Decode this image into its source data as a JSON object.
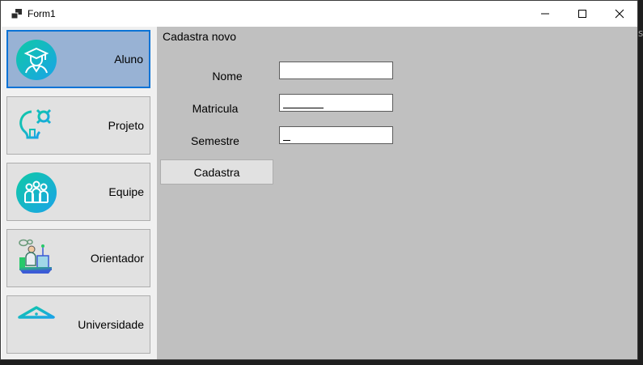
{
  "window": {
    "title": "Form1",
    "controls": [
      "minimize-icon",
      "maximize-icon",
      "close-icon"
    ]
  },
  "sidebar": {
    "items": [
      {
        "label": "Aluno",
        "icon": "graduate-icon",
        "active": true
      },
      {
        "label": "Projeto",
        "icon": "lightbulb-gear-icon",
        "active": false
      },
      {
        "label": "Equipe",
        "icon": "team-icon",
        "active": false
      },
      {
        "label": "Orientador",
        "icon": "teacher-laptop-icon",
        "active": false
      },
      {
        "label": "Universidade",
        "icon": "university-building-icon",
        "active": false
      }
    ]
  },
  "main": {
    "header": "Cadastra novo",
    "fields": [
      {
        "label": "Nome",
        "value": ""
      },
      {
        "label": "Matricula",
        "value": ""
      },
      {
        "label": "Semestre",
        "value": ""
      }
    ],
    "submit_label": "Cadastra"
  },
  "edge_text": "s",
  "colors": {
    "active_nav_bg": "#98b2d4",
    "active_nav_border": "#0a73d6",
    "main_bg": "#c0c0c0",
    "icon_gradient_start": "#10c9a6",
    "icon_gradient_end": "#1aa3e8"
  }
}
